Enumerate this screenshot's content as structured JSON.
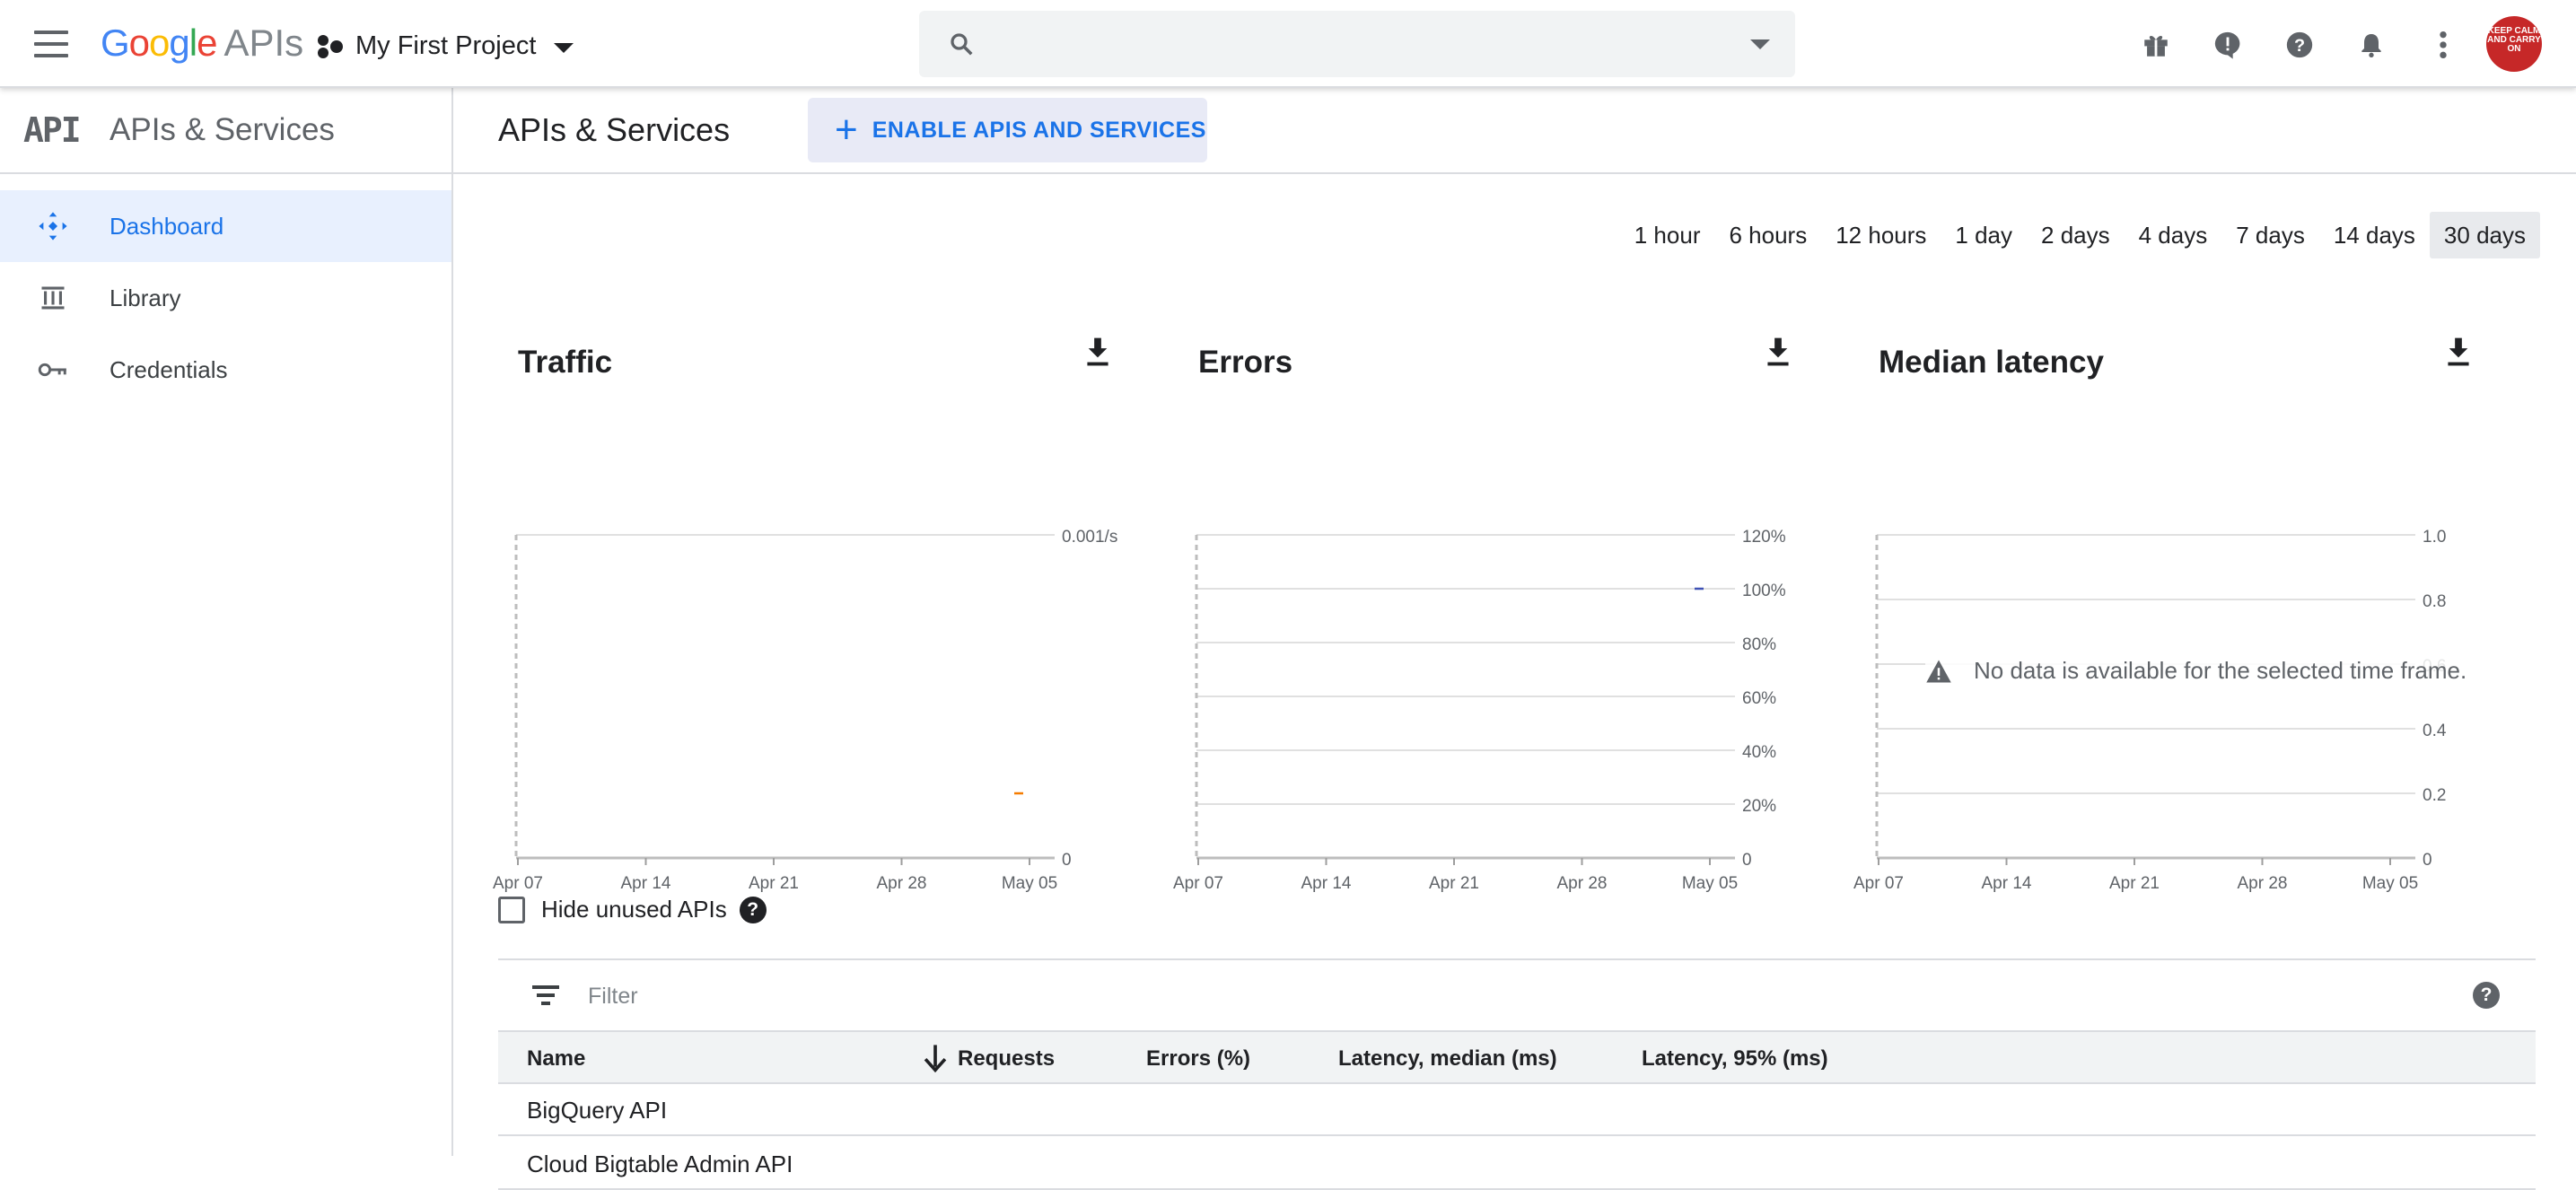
{
  "header": {
    "logo_google": "Google",
    "logo_apis": "APIs",
    "project_name": "My First Project",
    "search_placeholder": "",
    "avatar_text": "KEEP CALM AND CARRY ON"
  },
  "sidebar": {
    "badge": "API",
    "title": "APIs & Services",
    "items": [
      {
        "label": "Dashboard",
        "icon": "dashboard-icon",
        "active": true
      },
      {
        "label": "Library",
        "icon": "library-icon",
        "active": false
      },
      {
        "label": "Credentials",
        "icon": "key-icon",
        "active": false
      }
    ]
  },
  "main": {
    "title": "APIs & Services",
    "enable_button": "ENABLE APIS AND SERVICES",
    "time_ranges": [
      "1 hour",
      "6 hours",
      "12 hours",
      "1 day",
      "2 days",
      "4 days",
      "7 days",
      "14 days",
      "30 days"
    ],
    "selected_range": "30 days"
  },
  "charts": {
    "traffic_title": "Traffic",
    "errors_title": "Errors",
    "latency_title": "Median latency",
    "no_data_message": "No data is available for the selected time frame."
  },
  "chart_data": [
    {
      "type": "line",
      "title": "Traffic",
      "x": [
        "Apr 07",
        "Apr 14",
        "Apr 21",
        "Apr 28",
        "May 05"
      ],
      "y_ticks": [
        "0",
        "0.001/s"
      ],
      "ylim": [
        0,
        0.001
      ],
      "series": [
        {
          "values": [
            {
              "x": "May 05",
              "y": 0.0002
            }
          ]
        }
      ],
      "series_colors": [
        "#f57c00"
      ],
      "grid": true
    },
    {
      "type": "line",
      "title": "Errors",
      "x": [
        "Apr 07",
        "Apr 14",
        "Apr 21",
        "Apr 28",
        "May 05"
      ],
      "y_ticks": [
        "0",
        "20%",
        "40%",
        "60%",
        "80%",
        "100%",
        "120%"
      ],
      "ylim": [
        0,
        120
      ],
      "series": [
        {
          "values": [
            {
              "x": "May 05",
              "y": 100
            }
          ]
        }
      ],
      "series_colors": [
        "#3f51b5"
      ],
      "grid": true
    },
    {
      "type": "line",
      "title": "Median latency",
      "x": [
        "Apr 07",
        "Apr 14",
        "Apr 21",
        "Apr 28",
        "May 05"
      ],
      "y_ticks": [
        "0",
        "0.2",
        "0.4",
        "0.6",
        "0.8",
        "1.0"
      ],
      "ylim": [
        0,
        1.0
      ],
      "series": [],
      "grid": true
    }
  ],
  "apis": {
    "hide_unused_label": "Hide unused APIs",
    "filter_placeholder": "Filter",
    "columns": [
      "Name",
      "Requests",
      "Errors (%)",
      "Latency, median (ms)",
      "Latency, 95% (ms)"
    ],
    "rows": [
      "BigQuery API",
      "Cloud Bigtable Admin API"
    ]
  },
  "colors": {
    "accent": "#1a73e8",
    "enable_button_bg": "#e8eaf6",
    "traffic_series": "#f57c00",
    "errors_series": "#3f51b5"
  }
}
